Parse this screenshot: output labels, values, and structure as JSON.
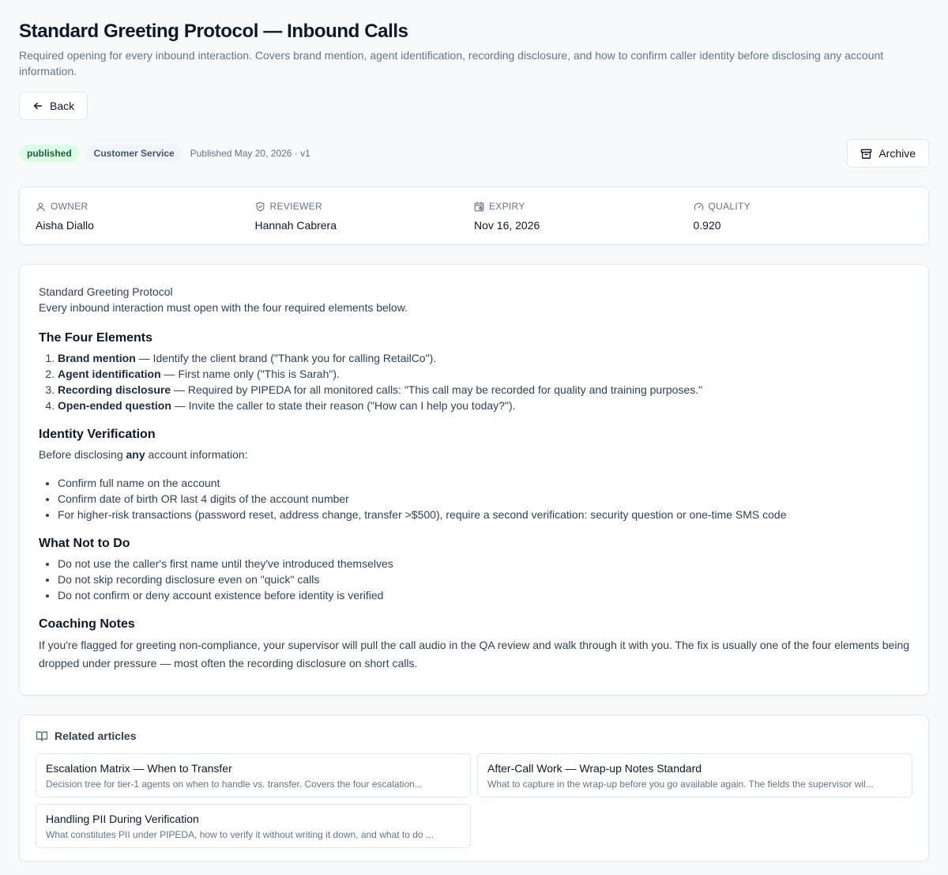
{
  "header": {
    "title": "Standard Greeting Protocol — Inbound Calls",
    "description": "Required opening for every inbound interaction. Covers brand mention, agent identification, recording disclosure, and how to confirm caller identity before disclosing any account information.",
    "back_label": "Back",
    "back_icon": "arrow-left-icon"
  },
  "meta": {
    "status": "published",
    "category": "Customer Service",
    "published_text": "Published May 20, 2026 · v1",
    "archive_label": "Archive",
    "archive_icon": "archive-icon",
    "colors": {
      "status_bg": "#dcfce7",
      "status_text": "#166534",
      "category_bg": "#f1f5f9"
    }
  },
  "info": {
    "owner": {
      "label": "OWNER",
      "value": "Aisha Diallo",
      "icon": "user-icon"
    },
    "reviewer": {
      "label": "REVIEWER",
      "value": "Hannah Cabrera",
      "icon": "shield-check-icon"
    },
    "expiry": {
      "label": "EXPIRY",
      "value": "Nov 16, 2026",
      "icon": "calendar-clock-icon"
    },
    "quality": {
      "label": "QUALITY",
      "value": "0.920",
      "icon": "gauge-icon"
    }
  },
  "article": {
    "intro_title": "Standard Greeting Protocol",
    "intro_text": "Every inbound interaction must open with the four required elements below.",
    "four_elements": {
      "heading": "The Four Elements",
      "items": [
        {
          "bold": "Brand mention",
          "rest": " — Identify the client brand (\"Thank you for calling RetailCo\")."
        },
        {
          "bold": "Agent identification",
          "rest": " — First name only (\"This is Sarah\")."
        },
        {
          "bold": "Recording disclosure",
          "rest": " — Required by PIPEDA for all monitored calls: \"This call may be recorded for quality and training purposes.\""
        },
        {
          "bold": "Open-ended question",
          "rest": " — Invite the caller to state their reason (\"How can I help you today?\")."
        }
      ]
    },
    "identity": {
      "heading": "Identity Verification",
      "lead_before": "Before disclosing ",
      "lead_bold": "any",
      "lead_after": " account information:",
      "items": [
        "Confirm full name on the account",
        "Confirm date of birth OR last 4 digits of the account number",
        "For higher-risk transactions (password reset, address change, transfer >$500), require a second verification: security question or one-time SMS code"
      ]
    },
    "not_to_do": {
      "heading": "What Not to Do",
      "items": [
        "Do not use the caller's first name until they've introduced themselves",
        "Do not skip recording disclosure even on \"quick\" calls",
        "Do not confirm or deny account existence before identity is verified"
      ]
    },
    "coaching": {
      "heading": "Coaching Notes",
      "text": "If you're flagged for greeting non-compliance, your supervisor will pull the call audio in the QA review and walk through it with you. The fix is usually one of the four elements being dropped under pressure — most often the recording disclosure on short calls."
    }
  },
  "related": {
    "heading": "Related articles",
    "icon": "book-open-icon",
    "items": [
      {
        "title": "Escalation Matrix — When to Transfer",
        "desc": "Decision tree for tier-1 agents on when to handle vs. transfer. Covers the four escalation..."
      },
      {
        "title": "After-Call Work — Wrap-up Notes Standard",
        "desc": "What to capture in the wrap-up before you go available again. The fields the supervisor wil..."
      },
      {
        "title": "Handling PII During Verification",
        "desc": "What constitutes PII under PIPEDA, how to verify it without writing it down, and what to do ..."
      }
    ]
  }
}
